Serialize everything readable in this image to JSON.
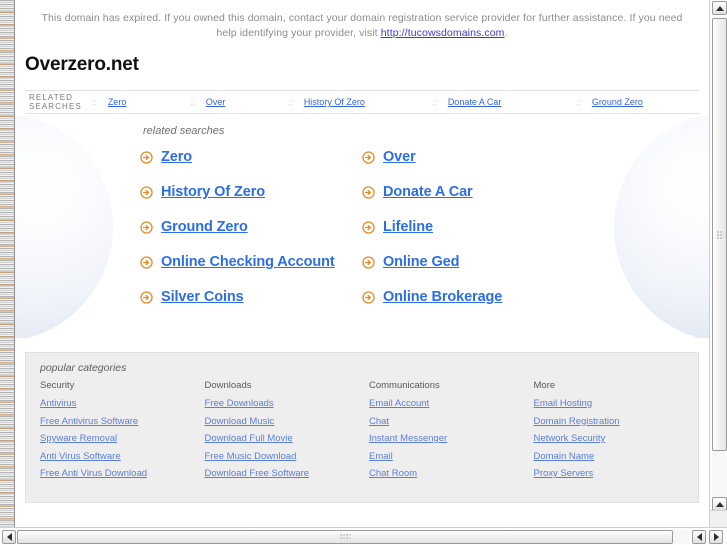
{
  "notice": {
    "line1": "This domain has expired. If you owned this domain, contact your domain registration service provider for further assistance. If you need help identifying your provider, visit ",
    "link_text": "http://tucowsdomains.com",
    "line_end": "."
  },
  "domain": {
    "title": "Overzero.net"
  },
  "related_bar": {
    "label": "RELATED SEARCHES",
    "separator": "::",
    "links": [
      "Zero",
      "Over",
      "History Of Zero",
      "Donate A Car",
      "Ground Zero"
    ]
  },
  "hero": {
    "caption": "related searches",
    "icon_name": "arrow-circle-right-icon",
    "icon_color": "#e98b22",
    "link_color": "#2b6ee8",
    "keywords": [
      "Zero",
      "Over",
      "History Of Zero",
      "Donate A Car",
      "Ground Zero",
      "Lifeline",
      "Online Checking Account",
      "Online Ged",
      "Silver Coins",
      "Online Brokerage"
    ]
  },
  "categories": {
    "caption": "popular categories",
    "columns": [
      {
        "heading": "Security",
        "links": [
          "Antivirus",
          "Free Antivirus Software",
          "Spyware Removal",
          "Anti Virus Software",
          "Free Anti Virus Download"
        ]
      },
      {
        "heading": "Downloads",
        "links": [
          "Free Downloads",
          "Download Music",
          "Download Full Movie",
          "Free Music Download",
          "Download Free Software"
        ]
      },
      {
        "heading": "Communications",
        "links": [
          "Email Account",
          "Chat",
          "Instant Messenger",
          "Email",
          "Chat Room"
        ]
      },
      {
        "heading": "More",
        "links": [
          "Email Hosting",
          "Domain Registration",
          "Network Security",
          "Domain Name",
          "Proxy Servers"
        ]
      }
    ]
  },
  "scrollbars": {
    "vertical_present": true,
    "horizontal_present": true
  }
}
